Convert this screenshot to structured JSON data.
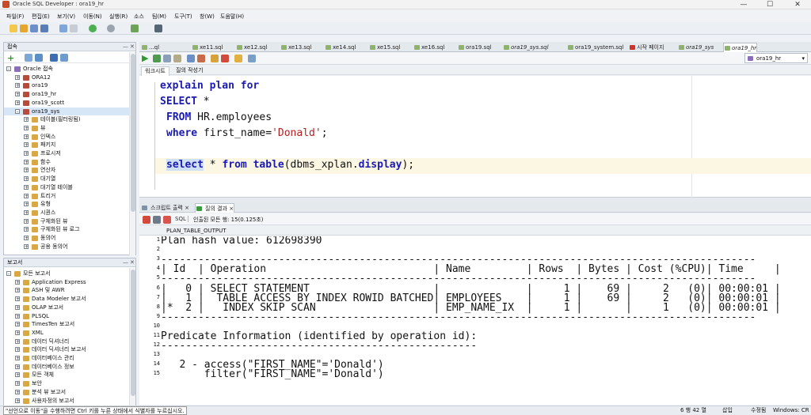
{
  "window": {
    "title": "Oracle SQL Developer : ora19_hr",
    "min": "—",
    "max": "☐",
    "close": "✕"
  },
  "menu": [
    "파일(F)",
    "편집(E)",
    "보기(V)",
    "이동(N)",
    "실행(R)",
    "소스",
    "팀(M)",
    "도구(T)",
    "창(W)",
    "도움말(H)"
  ],
  "connections": {
    "header": "접속",
    "items": [
      {
        "label": "Oracle 접속",
        "level": 0,
        "expander": "-"
      },
      {
        "label": "ORA12",
        "level": 1,
        "expander": "+"
      },
      {
        "label": "ora19",
        "level": 1,
        "expander": "+"
      },
      {
        "label": "ora19_hr",
        "level": 1,
        "expander": "+"
      },
      {
        "label": "ora19_scott",
        "level": 1,
        "expander": "+"
      },
      {
        "label": "ora19_sys",
        "level": 1,
        "expander": "-"
      },
      {
        "label": "테이블(필터링됨)",
        "level": 2,
        "expander": "+"
      },
      {
        "label": "뷰",
        "level": 2,
        "expander": "+"
      },
      {
        "label": "인덱스",
        "level": 2,
        "expander": "+"
      },
      {
        "label": "패키지",
        "level": 2,
        "expander": "+"
      },
      {
        "label": "프로시저",
        "level": 2,
        "expander": "+"
      },
      {
        "label": "함수",
        "level": 2,
        "expander": "+"
      },
      {
        "label": "연산자",
        "level": 2,
        "expander": "+"
      },
      {
        "label": "대기열",
        "level": 2,
        "expander": "+"
      },
      {
        "label": "대기열 테이블",
        "level": 2,
        "expander": "+"
      },
      {
        "label": "트리거",
        "level": 2,
        "expander": "+"
      },
      {
        "label": "유형",
        "level": 2,
        "expander": "+"
      },
      {
        "label": "시퀀스",
        "level": 2,
        "expander": "+"
      },
      {
        "label": "구체화된 뷰",
        "level": 2,
        "expander": "+"
      },
      {
        "label": "구체화된 뷰 로그",
        "level": 2,
        "expander": "+"
      },
      {
        "label": "동의어",
        "level": 2,
        "expander": "+"
      },
      {
        "label": "공용 동의어",
        "level": 2,
        "expander": "+"
      }
    ]
  },
  "reports": {
    "header": "보고서",
    "items": [
      {
        "label": "모든 보고서",
        "level": 0,
        "expander": "-"
      },
      {
        "label": "Application Express",
        "level": 1,
        "expander": "+"
      },
      {
        "label": "ASH 및 AWR",
        "level": 1,
        "expander": "+"
      },
      {
        "label": "Data Modeler 보고서",
        "level": 1,
        "expander": "+"
      },
      {
        "label": "OLAP 보고서",
        "level": 1,
        "expander": "+"
      },
      {
        "label": "PLSQL",
        "level": 1,
        "expander": "+"
      },
      {
        "label": "TimesTen 보고서",
        "level": 1,
        "expander": "+"
      },
      {
        "label": "XML",
        "level": 1,
        "expander": "+"
      },
      {
        "label": "데이터 딕셔너리",
        "level": 1,
        "expander": "+"
      },
      {
        "label": "데이터 딕셔너리 보고서",
        "level": 1,
        "expander": "+"
      },
      {
        "label": "데이터베이스 관리",
        "level": 1,
        "expander": "+"
      },
      {
        "label": "데이터베이스 정보",
        "level": 1,
        "expander": "+"
      },
      {
        "label": "모든 객체",
        "level": 1,
        "expander": "+"
      },
      {
        "label": "보안",
        "level": 1,
        "expander": "+"
      },
      {
        "label": "분석 뷰 보고서",
        "level": 1,
        "expander": "+"
      },
      {
        "label": "사용자정의 보고서",
        "level": 1,
        "expander": "+"
      }
    ]
  },
  "editor_tabs": [
    "...ql",
    "xe11.sql",
    "xe12.sql",
    "xe13.sql",
    "xe14.sql",
    "xe15.sql",
    "xe16.sql",
    "ora19.sql",
    "ora19_sys.sql",
    "ora19_system.sql",
    "시작 페이지",
    "ora19_sys",
    "ora19_hr"
  ],
  "connection_select": "ora19_hr",
  "sub_tabs": [
    "워크시트",
    "질의 작성기"
  ],
  "code": {
    "l1_kw1": "explain",
    "l1_kw2": "plan",
    "l1_kw3": "for",
    "l2_kw": "SELECT",
    "l2_rest": " *",
    "l3_kw": "FROM",
    "l3_rest": " HR.employees",
    "l4_kw": "where",
    "l4_a": " first_name=",
    "l4_str": "'Donald'",
    "l4_b": ";",
    "l5_kw1": "select",
    "l5_a": " * ",
    "l5_kw2": "from",
    "l5_b": " ",
    "l5_kw3": "table",
    "l5_c": "(dbms_xplan.",
    "l5_kw4": "display",
    "l5_d": ");"
  },
  "result_tabs": [
    "스크립트 출력",
    "질의 결과"
  ],
  "result_info": "인출된 모든 행: 15(0.125초)",
  "result_sql": "SQL",
  "column_header": "PLAN_TABLE_OUTPUT",
  "rows": [
    {
      "n": "1",
      "t": "Plan hash value: 612698390"
    },
    {
      "n": "2",
      "t": ""
    },
    {
      "n": "3",
      "t": "------------------------------------------------------------------------------------------------"
    },
    {
      "n": "4",
      "t": "| Id  | Operation                           | Name         | Rows  | Bytes | Cost (%CPU)| Time     |"
    },
    {
      "n": "5",
      "t": "------------------------------------------------------------------------------------------------"
    },
    {
      "n": "6",
      "t": "|   0 | SELECT STATEMENT                    |              |     1 |    69 |     2   (0)| 00:00:01 |"
    },
    {
      "n": "7",
      "t": "|   1 |  TABLE ACCESS BY INDEX ROWID BATCHED| EMPLOYEES    |     1 |    69 |     2   (0)| 00:00:01 |"
    },
    {
      "n": "8",
      "t": "|*  2 |   INDEX SKIP SCAN                   | EMP_NAME_IX  |     1 |       |     1   (0)| 00:00:01 |"
    },
    {
      "n": "9",
      "t": "------------------------------------------------------------------------------------------------"
    },
    {
      "n": "10",
      "t": ""
    },
    {
      "n": "11",
      "t": "Predicate Information (identified by operation id):"
    },
    {
      "n": "12",
      "t": "---------------------------------------------------"
    },
    {
      "n": "13",
      "t": ""
    },
    {
      "n": "14",
      "t": "   2 - access(\"FIRST_NAME\"='Donald')"
    },
    {
      "n": "15",
      "t": "       filter(\"FIRST_NAME\"='Donald')"
    }
  ],
  "status": {
    "hint": "\"선언으로 이동\"을 수행하려면 Ctrl 키를 누른 상태에서 식별자를 누르십시오.",
    "pos": "6 행 42 열",
    "mode": "삽입",
    "changed": "수정됨",
    "eol": "Windows: CR"
  }
}
